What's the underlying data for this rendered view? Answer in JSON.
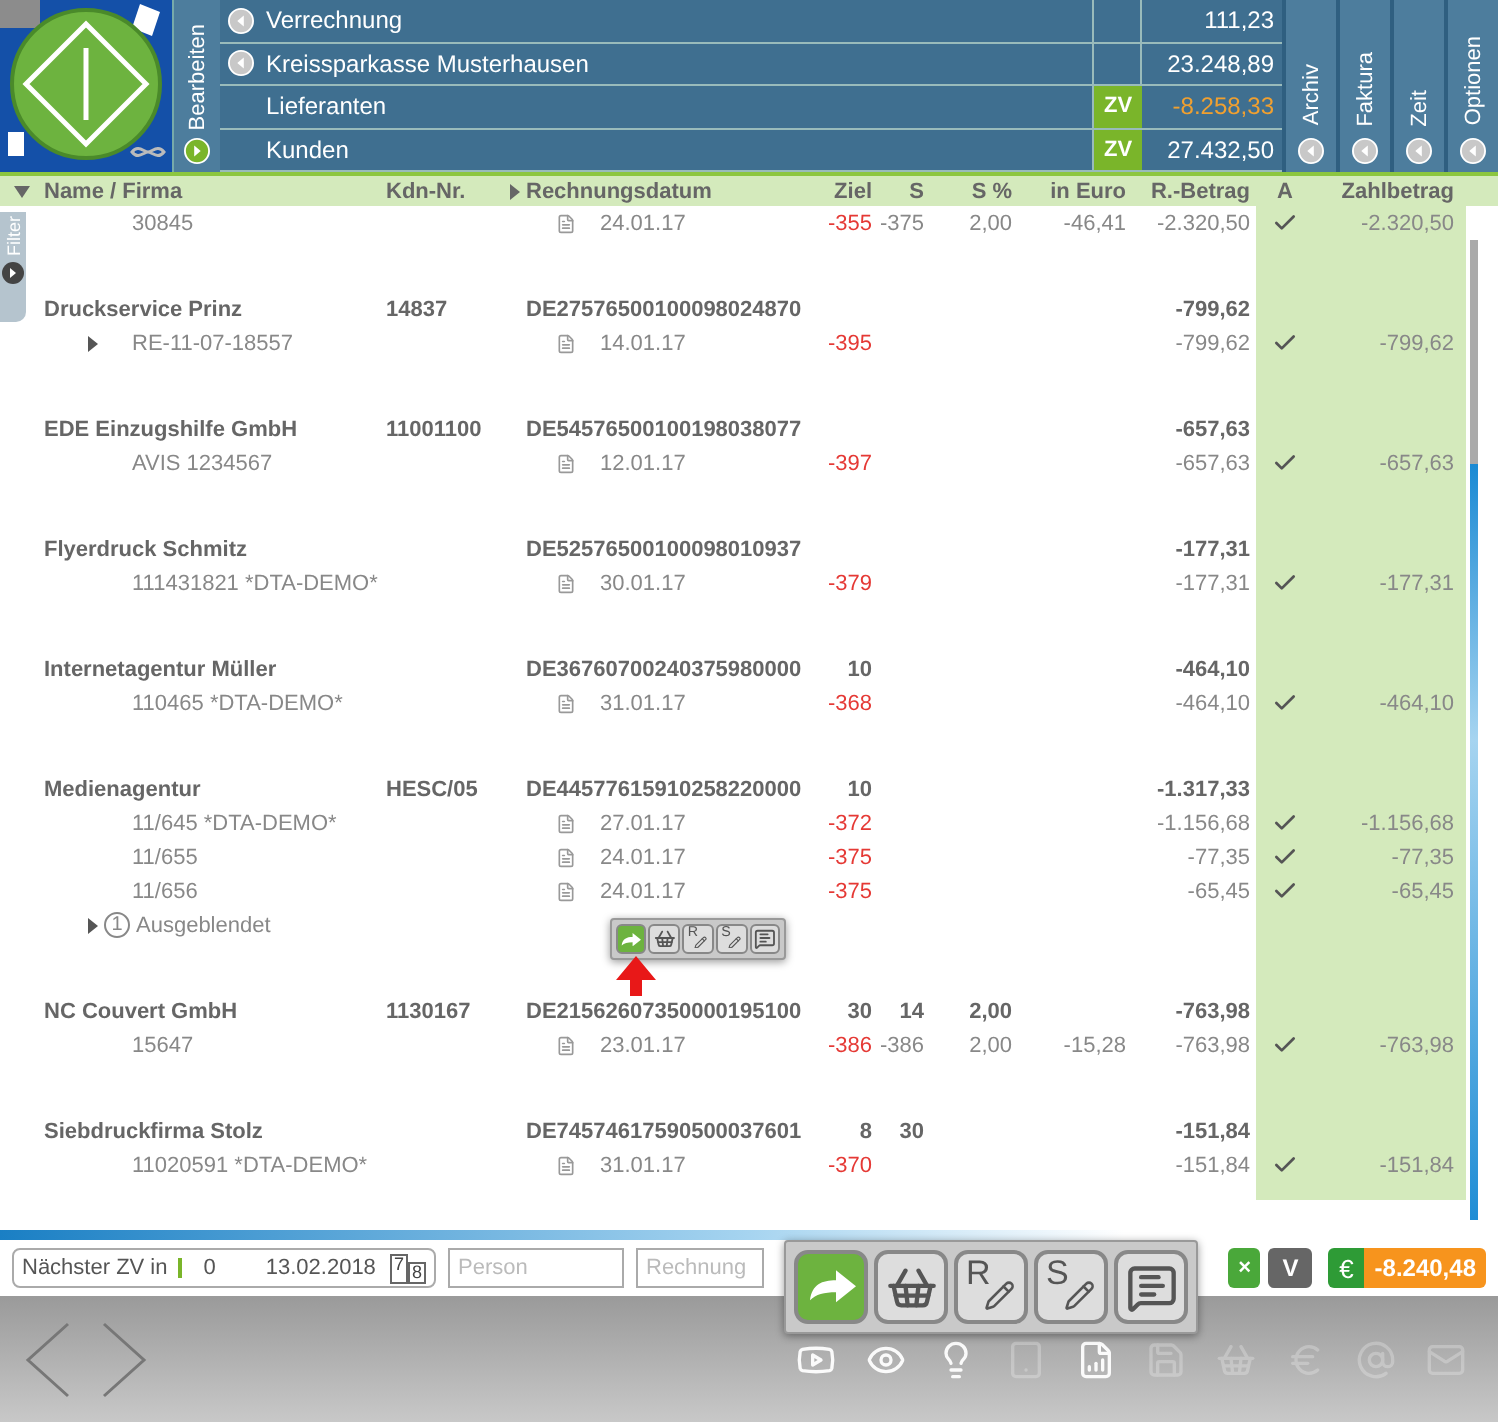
{
  "edit_tab": {
    "label": "Bearbeiten"
  },
  "accounts": [
    {
      "label": "Verrechnung",
      "kind": "account",
      "value": "111,23",
      "warning": false
    },
    {
      "label": "Kreissparkasse Musterhausen",
      "kind": "account",
      "value": "23.248,89",
      "warning": false
    },
    {
      "label": "Lieferanten",
      "kind": "zv",
      "badge": "ZV",
      "value": "-8.258,33",
      "warning": true
    },
    {
      "label": "Kunden",
      "kind": "zv",
      "badge": "ZV",
      "value": "27.432,50",
      "warning": false
    }
  ],
  "side_tabs": [
    "Archiv",
    "Faktura",
    "Zeit",
    "Optionen"
  ],
  "filter_tab": {
    "label": "Filter"
  },
  "columns": [
    "Name / Firma",
    "Kdn-Nr.",
    "Rechnungsdatum",
    "Ziel",
    "S",
    "S %",
    "in Euro",
    "R.-Betrag",
    "A",
    "Zahlbetrag"
  ],
  "groups": [
    {
      "items": [
        {
          "ref": "30845",
          "expandable": false,
          "date": "24.01.17",
          "ziel": "-355",
          "s": "-375",
          "s_pct": "2,00",
          "euro": "-46,41",
          "betrag": "-2.320,50",
          "checked": true,
          "zahl": "-2.320,50"
        }
      ]
    },
    {
      "name": "Druckservice Prinz",
      "kdn": "14837",
      "iban": "DE27576500100098024870",
      "betrag": "-799,62",
      "items": [
        {
          "ref": "RE-11-07-18557",
          "expandable": true,
          "date": "14.01.17",
          "ziel": "-395",
          "betrag": "-799,62",
          "checked": true,
          "zahl": "-799,62"
        }
      ]
    },
    {
      "name": "EDE Einzugshilfe GmbH",
      "kdn": "11001100",
      "iban": "DE54576500100198038077",
      "betrag": "-657,63",
      "items": [
        {
          "ref": "AVIS 1234567",
          "expandable": false,
          "date": "12.01.17",
          "ziel": "-397",
          "betrag": "-657,63",
          "checked": true,
          "zahl": "-657,63"
        }
      ]
    },
    {
      "name": "Flyerdruck Schmitz",
      "iban": "DE52576500100098010937",
      "betrag": "-177,31",
      "items": [
        {
          "ref": "111431821 *DTA-DEMO*",
          "expandable": false,
          "date": "30.01.17",
          "ziel": "-379",
          "betrag": "-177,31",
          "checked": true,
          "zahl": "-177,31"
        }
      ]
    },
    {
      "name": "Internetagentur Müller",
      "iban": "DE36760700240375980000",
      "ziel": "10",
      "betrag": "-464,10",
      "items": [
        {
          "ref": "110465 *DTA-DEMO*",
          "expandable": false,
          "date": "31.01.17",
          "ziel": "-368",
          "betrag": "-464,10",
          "checked": true,
          "zahl": "-464,10"
        }
      ]
    },
    {
      "name": "Medienagentur",
      "kdn": "HESC/05",
      "iban": "DE44577615910258220000",
      "ziel": "10",
      "betrag": "-1.317,33",
      "items": [
        {
          "ref": "11/645 *DTA-DEMO*",
          "expandable": false,
          "date": "27.01.17",
          "ziel": "-372",
          "betrag": "-1.156,68",
          "checked": true,
          "zahl": "-1.156,68"
        },
        {
          "ref": "11/655",
          "expandable": false,
          "date": "24.01.17",
          "ziel": "-375",
          "betrag": "-77,35",
          "checked": true,
          "zahl": "-77,35"
        },
        {
          "ref": "11/656",
          "expandable": false,
          "date": "24.01.17",
          "ziel": "-375",
          "betrag": "-65,45",
          "checked": true,
          "zahl": "-65,45"
        }
      ],
      "hidden": {
        "count": "1",
        "label": "Ausgeblendet"
      }
    },
    {
      "name": "NC Couvert GmbH",
      "kdn": "1130167",
      "iban": "DE21562607350000195100",
      "ziel": "30",
      "s": "14",
      "s_pct": "2,00",
      "betrag": "-763,98",
      "items": [
        {
          "ref": "15647",
          "expandable": false,
          "date": "23.01.17",
          "ziel": "-386",
          "s": "-386",
          "s_pct": "2,00",
          "euro": "-15,28",
          "betrag": "-763,98",
          "checked": true,
          "zahl": "-763,98"
        }
      ]
    },
    {
      "name": "Siebdruckfirma Stolz",
      "iban": "DE74574617590500037601",
      "ziel": "8",
      "s": "30",
      "betrag": "-151,84",
      "items": [
        {
          "ref": "11020591 *DTA-DEMO*",
          "expandable": false,
          "date": "31.01.17",
          "ziel": "-370",
          "betrag": "-151,84",
          "checked": true,
          "zahl": "-151,84"
        }
      ]
    }
  ],
  "row_popup": [
    {
      "kind": "forward",
      "selected": true
    },
    {
      "kind": "basket",
      "selected": false
    },
    {
      "kind": "letter",
      "letter": "R",
      "selected": false
    },
    {
      "kind": "letter",
      "letter": "S",
      "selected": false
    },
    {
      "kind": "comment",
      "selected": false
    }
  ],
  "next_zv": {
    "label": "Nächster ZV in",
    "days": "0",
    "date": "13.02.2018",
    "calendar": [
      "7",
      "8"
    ]
  },
  "person_field": {
    "placeholder": "Person"
  },
  "invoice_field": {
    "placeholder": "Rechnung"
  },
  "close_button": {
    "label": "×"
  },
  "v_button": {
    "label": "V"
  },
  "total": {
    "symbol": "€",
    "value": "-8.240,48"
  },
  "action_bar": [
    {
      "kind": "forward",
      "selected": true
    },
    {
      "kind": "basket",
      "selected": false
    },
    {
      "kind": "letter",
      "letter": "R",
      "selected": false
    },
    {
      "kind": "letter",
      "letter": "S",
      "selected": false
    },
    {
      "kind": "comment",
      "selected": false
    }
  ],
  "footer_icons": [
    {
      "kind": "video",
      "enabled": true
    },
    {
      "kind": "eye",
      "enabled": true
    },
    {
      "kind": "idea",
      "enabled": true
    },
    {
      "kind": "tablet",
      "enabled": false
    },
    {
      "kind": "report",
      "enabled": true
    },
    {
      "kind": "save",
      "enabled": false
    },
    {
      "kind": "basket",
      "enabled": false
    },
    {
      "kind": "euro",
      "enabled": false
    },
    {
      "kind": "at",
      "enabled": false
    },
    {
      "kind": "mail",
      "enabled": false
    }
  ]
}
